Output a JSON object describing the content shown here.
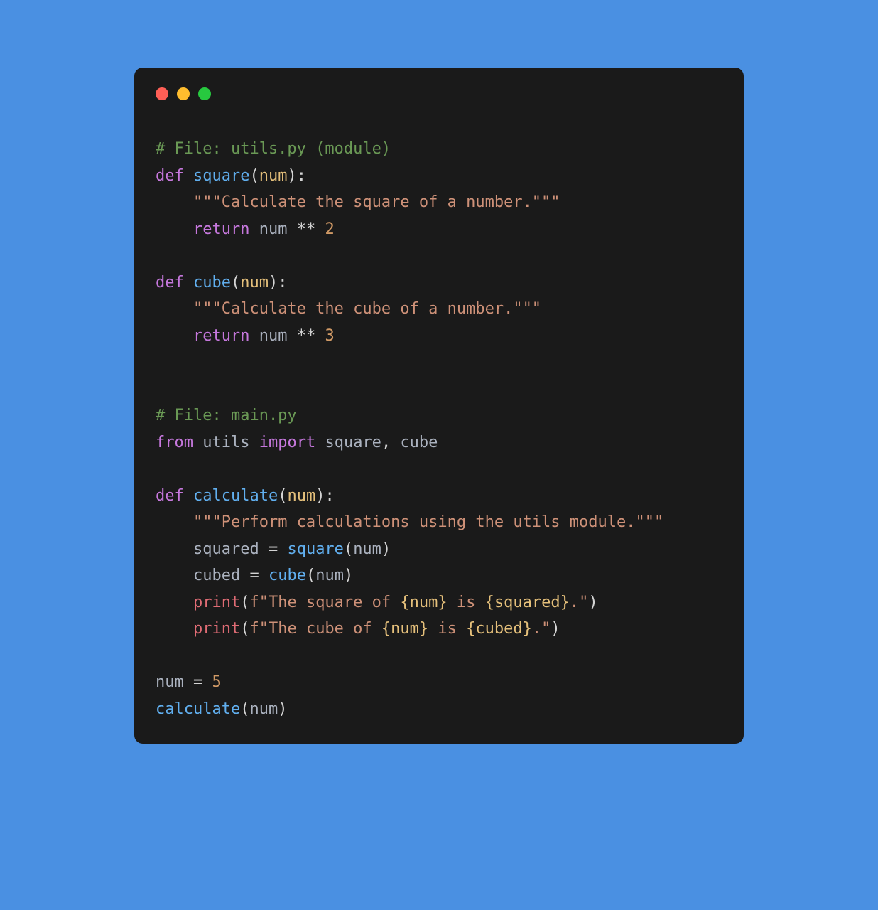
{
  "window": {
    "traffic_lights": [
      "close",
      "minimize",
      "zoom"
    ]
  },
  "code": {
    "comment1": "# File: utils.py (module)",
    "def1_kw": "def",
    "def1_name": "square",
    "def1_param": "num",
    "doc1": "\"\"\"Calculate the square of a number.\"\"\"",
    "return_kw": "return",
    "pow_op": "**",
    "two": "2",
    "def2_name": "cube",
    "def2_param": "num",
    "doc2": "\"\"\"Calculate the cube of a number.\"\"\"",
    "three": "3",
    "comment2": "# File: main.py",
    "from_kw": "from",
    "import_kw": "import",
    "utils_mod": "utils",
    "imp_square": "square",
    "imp_cube": "cube",
    "def3_name": "calculate",
    "def3_param": "num",
    "doc3": "\"\"\"Perform calculations using the utils module.\"\"\"",
    "var_squared": "squared",
    "var_cubed": "cubed",
    "call_square": "square",
    "call_cube": "cube",
    "call_num": "num",
    "print_fn": "print",
    "fprefix": "f",
    "str_sq_1": "\"The square of ",
    "str_is": " is ",
    "str_dot": ".\"",
    "str_cu_1": "\"The cube of ",
    "interp_num": "{num}",
    "interp_squared": "{squared}",
    "interp_cubed": "{cubed}",
    "assign_num": "num",
    "five": "5",
    "call_calculate": "calculate",
    "eq": " = ",
    "comma_sp": ", ",
    "lparen": "(",
    "rparen": ")",
    "colon": ":",
    "indent": "    "
  }
}
